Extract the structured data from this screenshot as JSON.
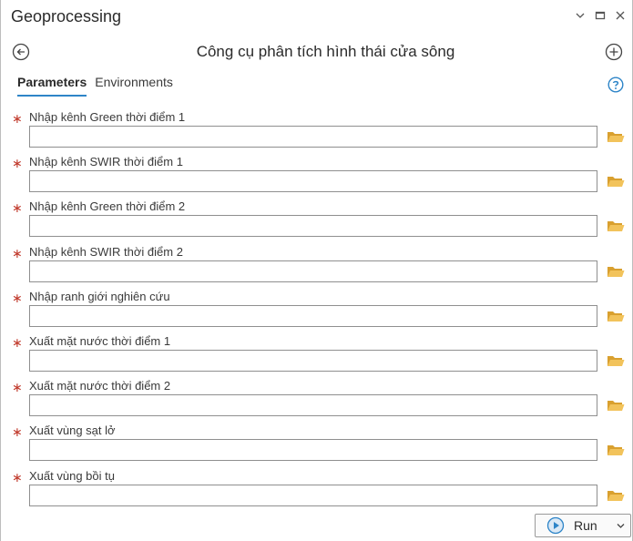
{
  "window": {
    "title": "Geoprocessing",
    "controls": [
      "chevron-down-icon",
      "maximize-icon",
      "close-icon"
    ]
  },
  "tool": {
    "title": "Công cụ phân tích hình thái cửa sông",
    "back_icon": "back-arrow-circle-icon",
    "add_icon": "plus-circle-icon"
  },
  "tabs": [
    {
      "label": "Parameters",
      "active": true
    },
    {
      "label": "Environments",
      "active": false
    }
  ],
  "help_icon": "help-icon",
  "parameters": [
    {
      "label": "Nhập kênh Green thời điểm 1",
      "value": "",
      "required": true
    },
    {
      "label": "Nhập kênh SWIR thời điểm 1",
      "value": "",
      "required": true
    },
    {
      "label": "Nhập kênh Green thời điểm 2",
      "value": "",
      "required": true
    },
    {
      "label": "Nhập kênh SWIR thời điểm 2",
      "value": "",
      "required": true
    },
    {
      "label": "Nhập ranh giới nghiên cứu",
      "value": "",
      "required": true
    },
    {
      "label": "Xuất mặt nước thời điểm 1",
      "value": "",
      "required": true
    },
    {
      "label": "Xuất mặt nước thời điểm 2",
      "value": "",
      "required": true
    },
    {
      "label": "Xuất vùng sạt lở",
      "value": "",
      "required": true
    },
    {
      "label": "Xuất vùng bồi tụ",
      "value": "",
      "required": true
    }
  ],
  "required_marker": "∗",
  "run": {
    "label": "Run"
  },
  "colors": {
    "accent": "#2e85c8",
    "required": "#c0392b",
    "folder": "#e9b543"
  }
}
